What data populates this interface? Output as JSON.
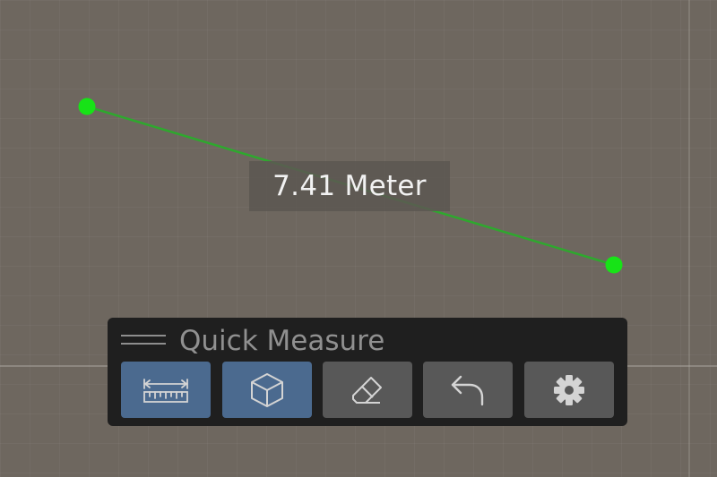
{
  "measurement": {
    "distance_label": "7.41 Meter",
    "line_color": "#2ea82e",
    "point_color": "#17e317"
  },
  "panel": {
    "title": "Quick Measure",
    "tools": [
      {
        "id": "ruler",
        "icon": "ruler-icon",
        "active": true
      },
      {
        "id": "3d-object",
        "icon": "cube-icon",
        "active": true
      },
      {
        "id": "erase",
        "icon": "eraser-icon",
        "active": false
      },
      {
        "id": "undo",
        "icon": "undo-icon",
        "active": false
      },
      {
        "id": "settings",
        "icon": "gear-icon",
        "active": false
      }
    ]
  },
  "colors": {
    "viewport_background": "#6e675f",
    "panel_background": "#1f1f1f",
    "button_active": "#4b6a8f",
    "button_inactive": "#585858",
    "icon_color": "#d4d4d4"
  }
}
